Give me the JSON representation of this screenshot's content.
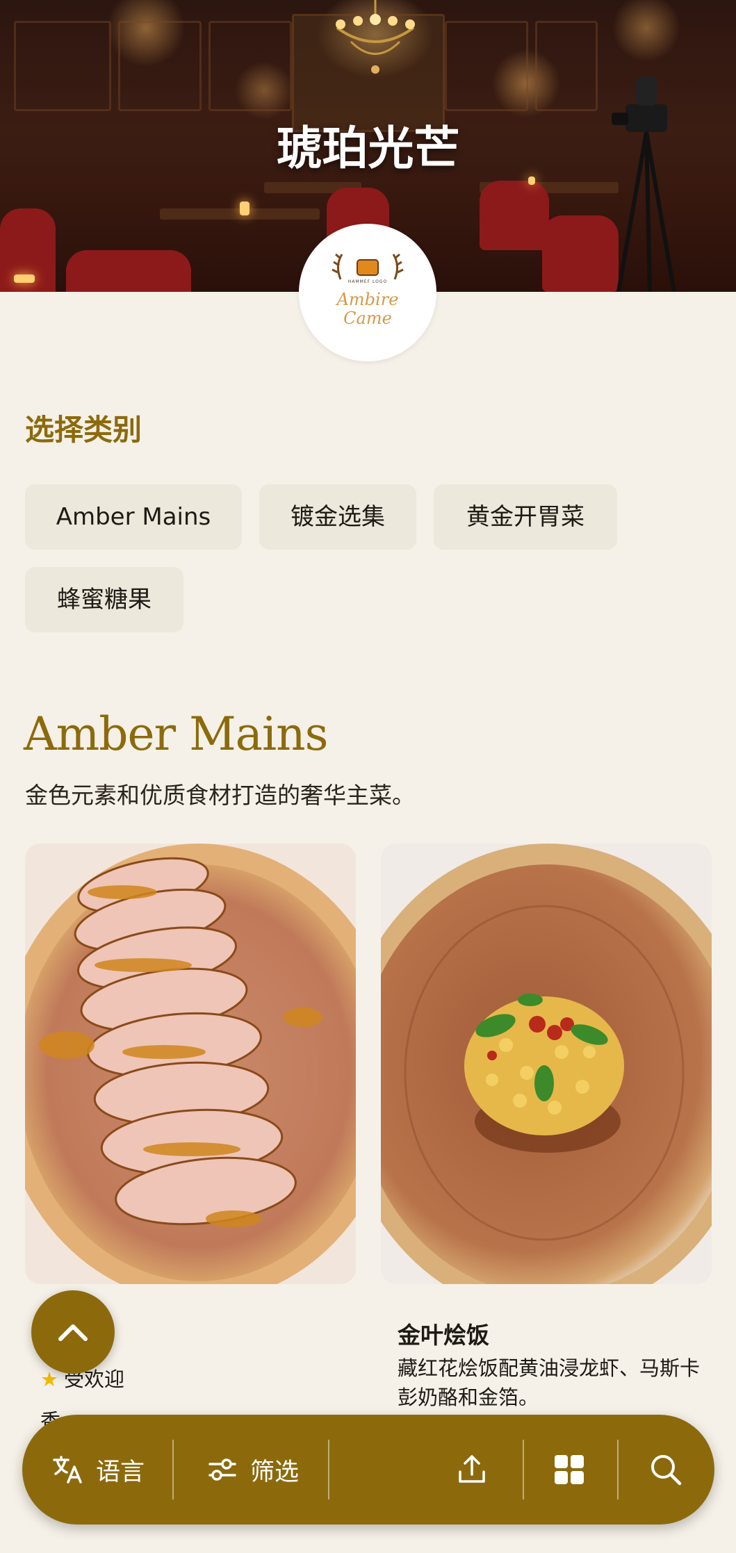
{
  "hero": {
    "title": "琥珀光芒",
    "logo_tagline": "HAMMEF LOGO",
    "logo_line1": "Ambire",
    "logo_line2": "Came"
  },
  "categories": {
    "heading": "选择类别",
    "items": [
      {
        "label": "Amber Mains"
      },
      {
        "label": "镀金选集"
      },
      {
        "label": "黄金开胃菜"
      },
      {
        "label": "蜂蜜糖果"
      }
    ]
  },
  "section": {
    "title": "Amber Mains",
    "description": "金色元素和优质食材打造的奢华主菜。"
  },
  "dishes": [
    {
      "name": "",
      "badge": "受欢迎",
      "badge_icon": "star-icon",
      "description_partial": "香",
      "image": "roast-pork-plate"
    },
    {
      "name": "金叶烩饭",
      "description": "藏红花烩饭配黄油浸龙虾、马斯卡彭奶酪和金箔。",
      "image": "saffron-risotto-plate"
    }
  ],
  "bottom_bar": {
    "language_label": "语言",
    "filter_label": "筛选",
    "icons": [
      "translate-icon",
      "filter-icon",
      "share-icon",
      "grid-icon",
      "search-icon"
    ]
  },
  "colors": {
    "accent": "#8c6a0c",
    "background": "#f5f1e8",
    "chip_bg": "#ece8dc"
  }
}
